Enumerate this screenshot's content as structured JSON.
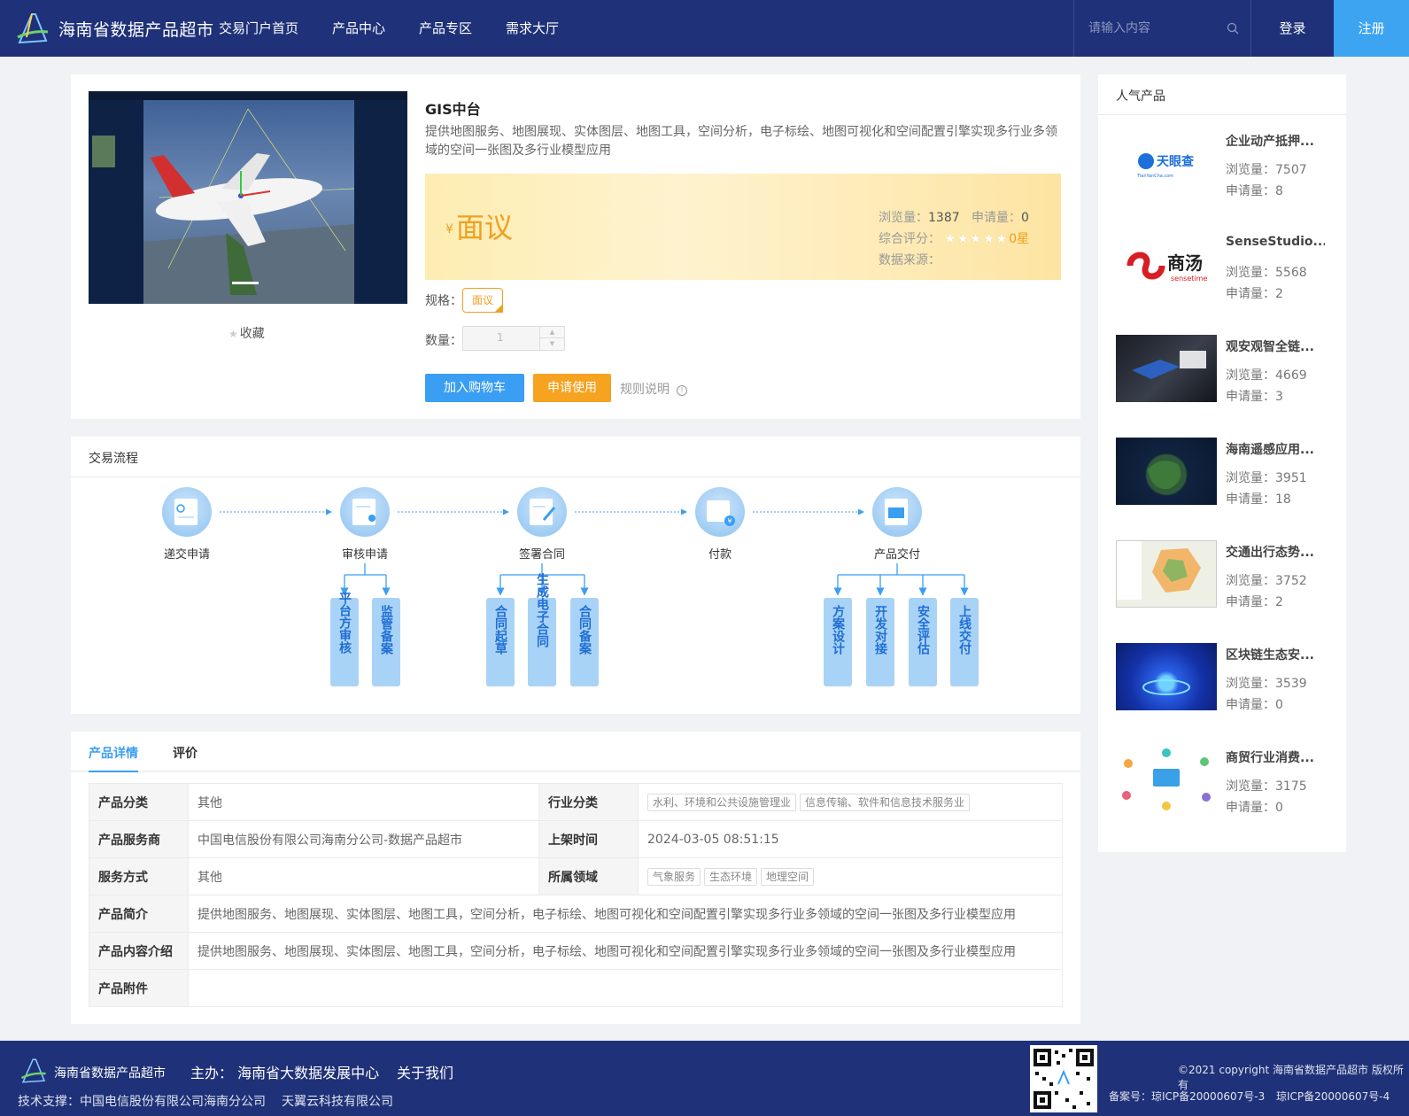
{
  "header": {
    "site_title": "海南省数据产品超市",
    "nav": [
      "交易门户首页",
      "产品中心",
      "产品专区",
      "需求大厅"
    ],
    "search_placeholder": "请输入内容",
    "login": "登录",
    "register": "注册"
  },
  "product": {
    "title": "GIS中台",
    "description": "提供地图服务、地图展现、实体图层、地图工具，空间分析，电子标绘、地图可视化和空间配置引擎实现多行业多领域的空间一张图及多行业模型应用",
    "favorite": "收藏",
    "price_symbol": "¥",
    "price": "面议",
    "views_label": "浏览量：",
    "views": "1387",
    "applies_label": "申请量：",
    "applies": "0",
    "rating_label": "综合评分：",
    "rating_stars": 0,
    "rating_text": "0星",
    "source_label": "数据来源：",
    "spec_label": "规格：",
    "spec_value": "面议",
    "qty_label": "数量：",
    "qty_value": "1",
    "add_cart": "加入购物车",
    "apply": "申请使用",
    "rules": "规则说明"
  },
  "flow": {
    "title": "交易流程",
    "steps": [
      "递交申请",
      "审核申请",
      "签署合同",
      "付款",
      "产品交付"
    ],
    "substeps": {
      "审核申请": [
        "平台方审核",
        "监管备案"
      ],
      "签署合同": [
        "合同起草",
        "生成电子合同",
        "合同备案"
      ],
      "产品交付": [
        "方案设计",
        "开发对接",
        "安全评估",
        "上线交付"
      ]
    }
  },
  "details": {
    "tabs": [
      "产品详情",
      "评价"
    ],
    "rows": {
      "category_label": "产品分类",
      "category": "其他",
      "industry_label": "行业分类",
      "industry_tags": [
        "水利、环境和公共设施管理业",
        "信息传输、软件和信息技术服务业"
      ],
      "provider_label": "产品服务商",
      "provider": "中国电信股份有限公司海南分公司-数据产品超市",
      "listed_label": "上架时间",
      "listed": "2024-03-05 08:51:15",
      "service_label": "服务方式",
      "service": "其他",
      "domain_label": "所属领域",
      "domain_tags": [
        "气象服务",
        "生态环境",
        "地理空间"
      ],
      "intro_label": "产品简介",
      "intro": "提供地图服务、地图展现、实体图层、地图工具，空间分析，电子标绘、地图可视化和空间配置引擎实现多行业多领域的空间一张图及多行业模型应用",
      "content_label": "产品内容介绍",
      "content": "提供地图服务、地图展现、实体图层、地图工具，空间分析，电子标绘、地图可视化和空间配置引擎实现多行业多领域的空间一张图及多行业模型应用",
      "attach_label": "产品附件",
      "attach": ""
    }
  },
  "hot": {
    "title": "人气产品",
    "views_label": "浏览量：",
    "applies_label": "申请量：",
    "items": [
      {
        "name": "企业动产抵押...",
        "views": "7507",
        "applies": "8",
        "logo_text": "天眼查",
        "logo_sub": "TianYanCha.com"
      },
      {
        "name": "SenseStudio...",
        "views": "5568",
        "applies": "2",
        "logo_text": "商汤",
        "logo_sub": "sensetime"
      },
      {
        "name": "观安观智全链...",
        "views": "4669",
        "applies": "3"
      },
      {
        "name": "海南遥感应用...",
        "views": "3951",
        "applies": "18"
      },
      {
        "name": "交通出行态势...",
        "views": "3752",
        "applies": "2"
      },
      {
        "name": "区块链生态安...",
        "views": "3539",
        "applies": "0"
      },
      {
        "name": "商贸行业消费...",
        "views": "3175",
        "applies": "0"
      }
    ]
  },
  "footer": {
    "title": "海南省数据产品超市",
    "host": "主办： 海南省大数据发展中心",
    "about": "关于我们",
    "tech": "技术支撑：中国电信股份有限公司海南分公司",
    "tech2": "天翼云科技有限公司",
    "copyright": "©2021 copyright 海南省数据产品超市 版权所有",
    "icp1": "备案号：琼ICP备20000607号-3",
    "icp2": "琼ICP备20000607号-4"
  },
  "colors": {
    "primary": "#3a9ef3",
    "navy": "#1f3178",
    "orange": "#f5a320"
  }
}
